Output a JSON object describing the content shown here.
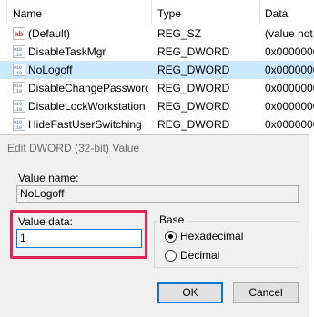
{
  "columns": {
    "name": "Name",
    "type": "Type",
    "data": "Data"
  },
  "rows": [
    {
      "icon": "string-value-icon",
      "name": "(Default)",
      "type": "REG_SZ",
      "data": "(value not"
    },
    {
      "icon": "binary-value-icon",
      "name": "DisableTaskMgr",
      "type": "REG_DWORD",
      "data": "0x0000000"
    },
    {
      "icon": "binary-value-icon",
      "name": "NoLogoff",
      "type": "REG_DWORD",
      "data": "0x0000000",
      "selected": true
    },
    {
      "icon": "binary-value-icon",
      "name": "DisableChangePassword",
      "type": "REG_DWORD",
      "data": "0x0000000"
    },
    {
      "icon": "binary-value-icon",
      "name": "DisableLockWorkstation",
      "type": "REG_DWORD",
      "data": "0x0000000"
    },
    {
      "icon": "binary-value-icon",
      "name": "HideFastUserSwitching",
      "type": "REG_DWORD",
      "data": "0x0000000"
    }
  ],
  "dialog": {
    "title": "Edit DWORD (32-bit) Value",
    "value_name_label": "Value name:",
    "value_name": "NoLogoff",
    "value_data_label": "Value data:",
    "value_data": "1",
    "base_label": "Base",
    "base_options": [
      "Hexadecimal",
      "Decimal"
    ],
    "base_selected": "Hexadecimal",
    "ok_label": "OK",
    "cancel_label": "Cancel"
  },
  "colors": {
    "highlight": "#e0245e",
    "selection": "#cce8ff",
    "default_button": "#0078d7"
  }
}
